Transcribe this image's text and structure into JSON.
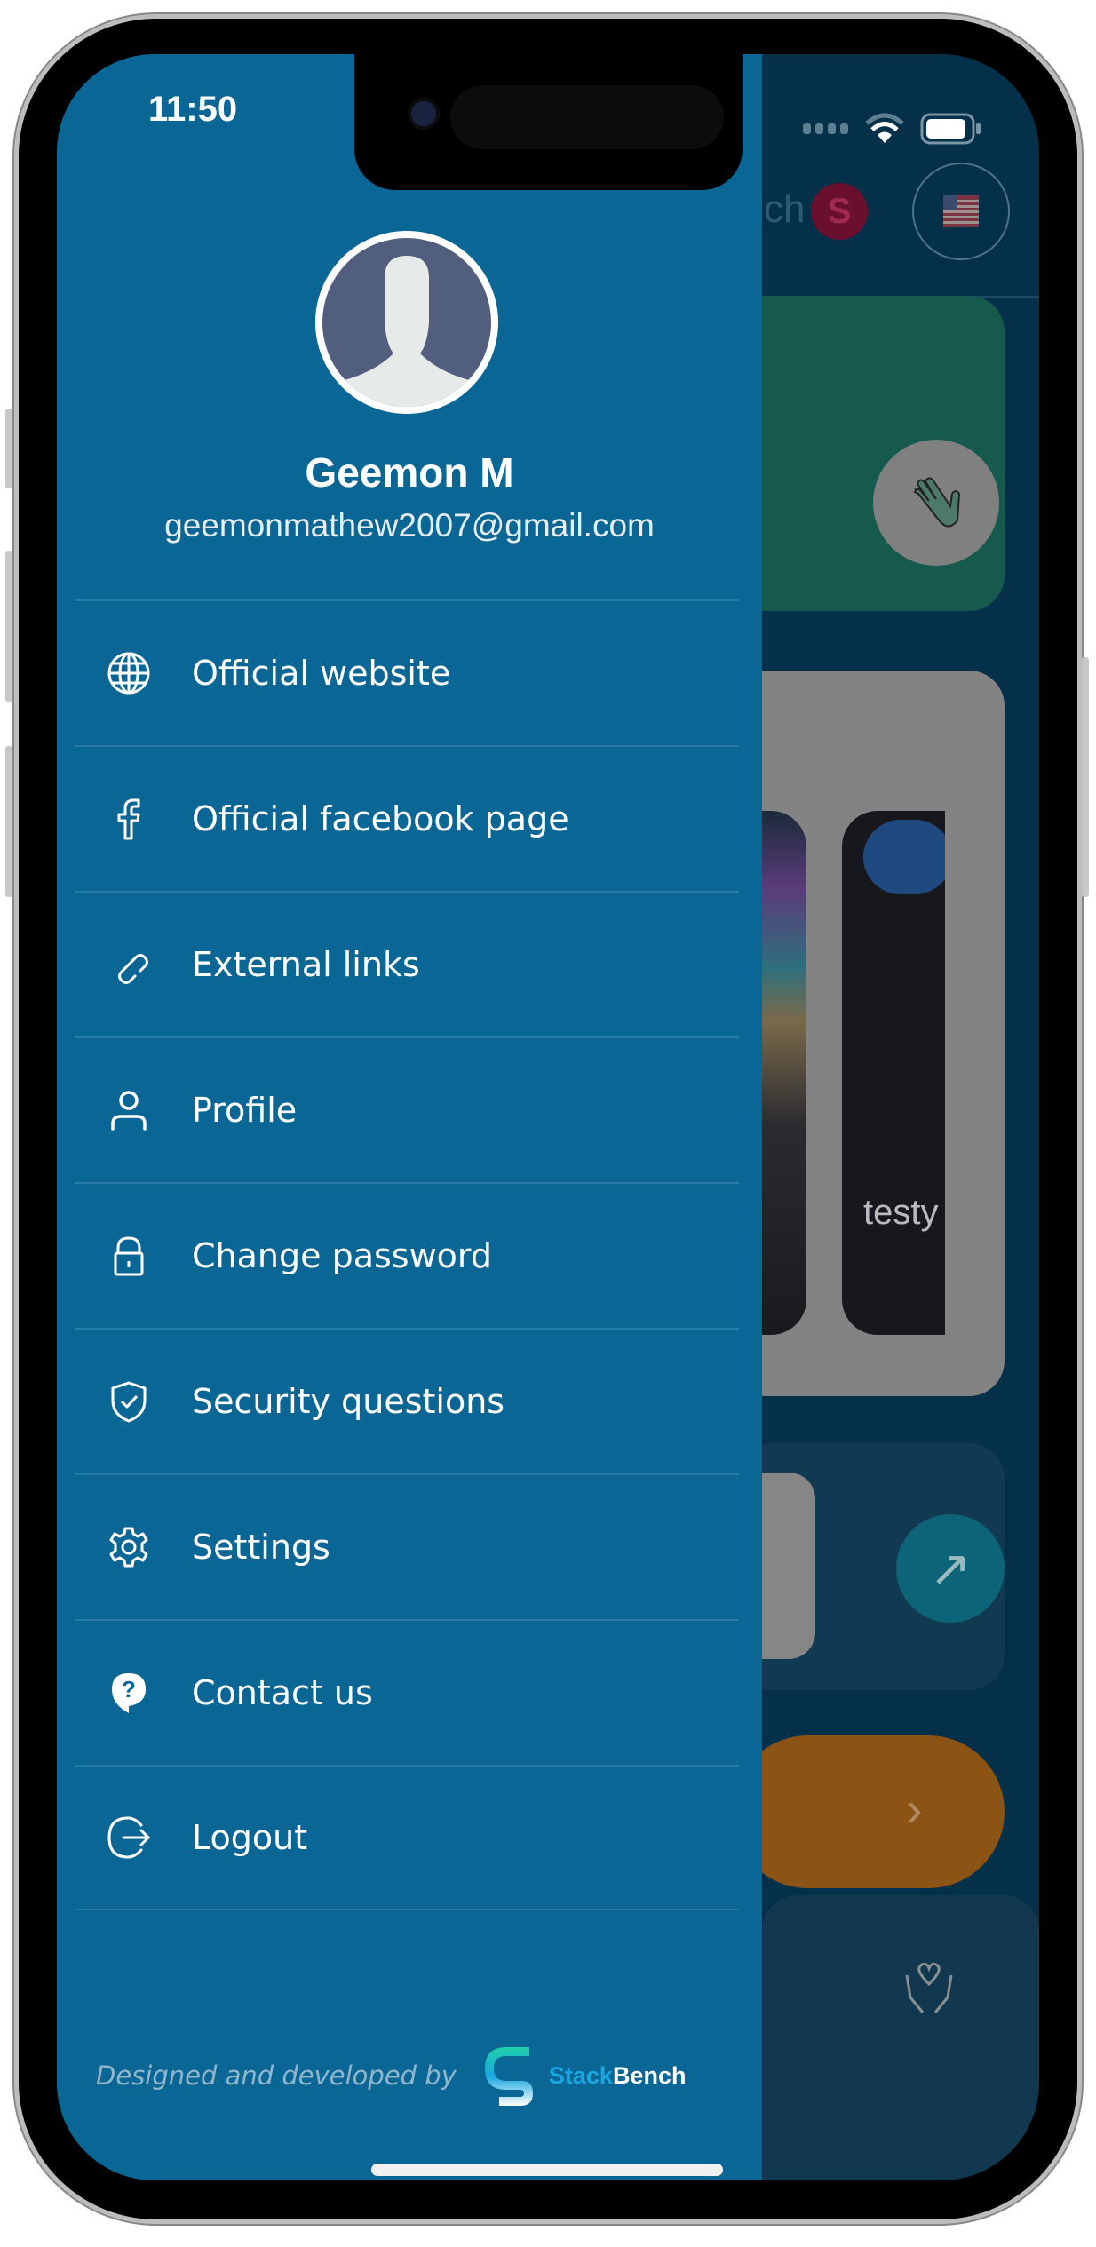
{
  "status_bar": {
    "time": "11:50"
  },
  "user": {
    "name": "Geemon M",
    "email": "geemonmathew2007@gmail.com"
  },
  "menu": [
    {
      "label": "Official website",
      "icon": "globe-icon"
    },
    {
      "label": "Official facebook page",
      "icon": "facebook-icon"
    },
    {
      "label": "External links",
      "icon": "link-icon"
    },
    {
      "label": "Profile",
      "icon": "user-icon"
    },
    {
      "label": "Change password",
      "icon": "lock-icon"
    },
    {
      "label": "Security questions",
      "icon": "shield-check-icon"
    },
    {
      "label": "Settings",
      "icon": "gear-icon"
    },
    {
      "label": "Contact us",
      "icon": "help-bubble-icon"
    },
    {
      "label": "Logout",
      "icon": "logout-icon"
    }
  ],
  "footer": {
    "designed_by": "Designed and developed by",
    "brand_part1": "Stack",
    "brand_part2": "Bench"
  },
  "background": {
    "header_partial": "ch",
    "badge_letter": "S",
    "card_text_partial": "testy"
  },
  "colors": {
    "drawer": "#0a6795",
    "background": "#053049",
    "badge": "#6b0f2e",
    "green_card": "#155a4c",
    "orange_button": "#8c5414",
    "brand_teal": "#1fd0a8",
    "brand_blue": "#1aa6e0"
  }
}
